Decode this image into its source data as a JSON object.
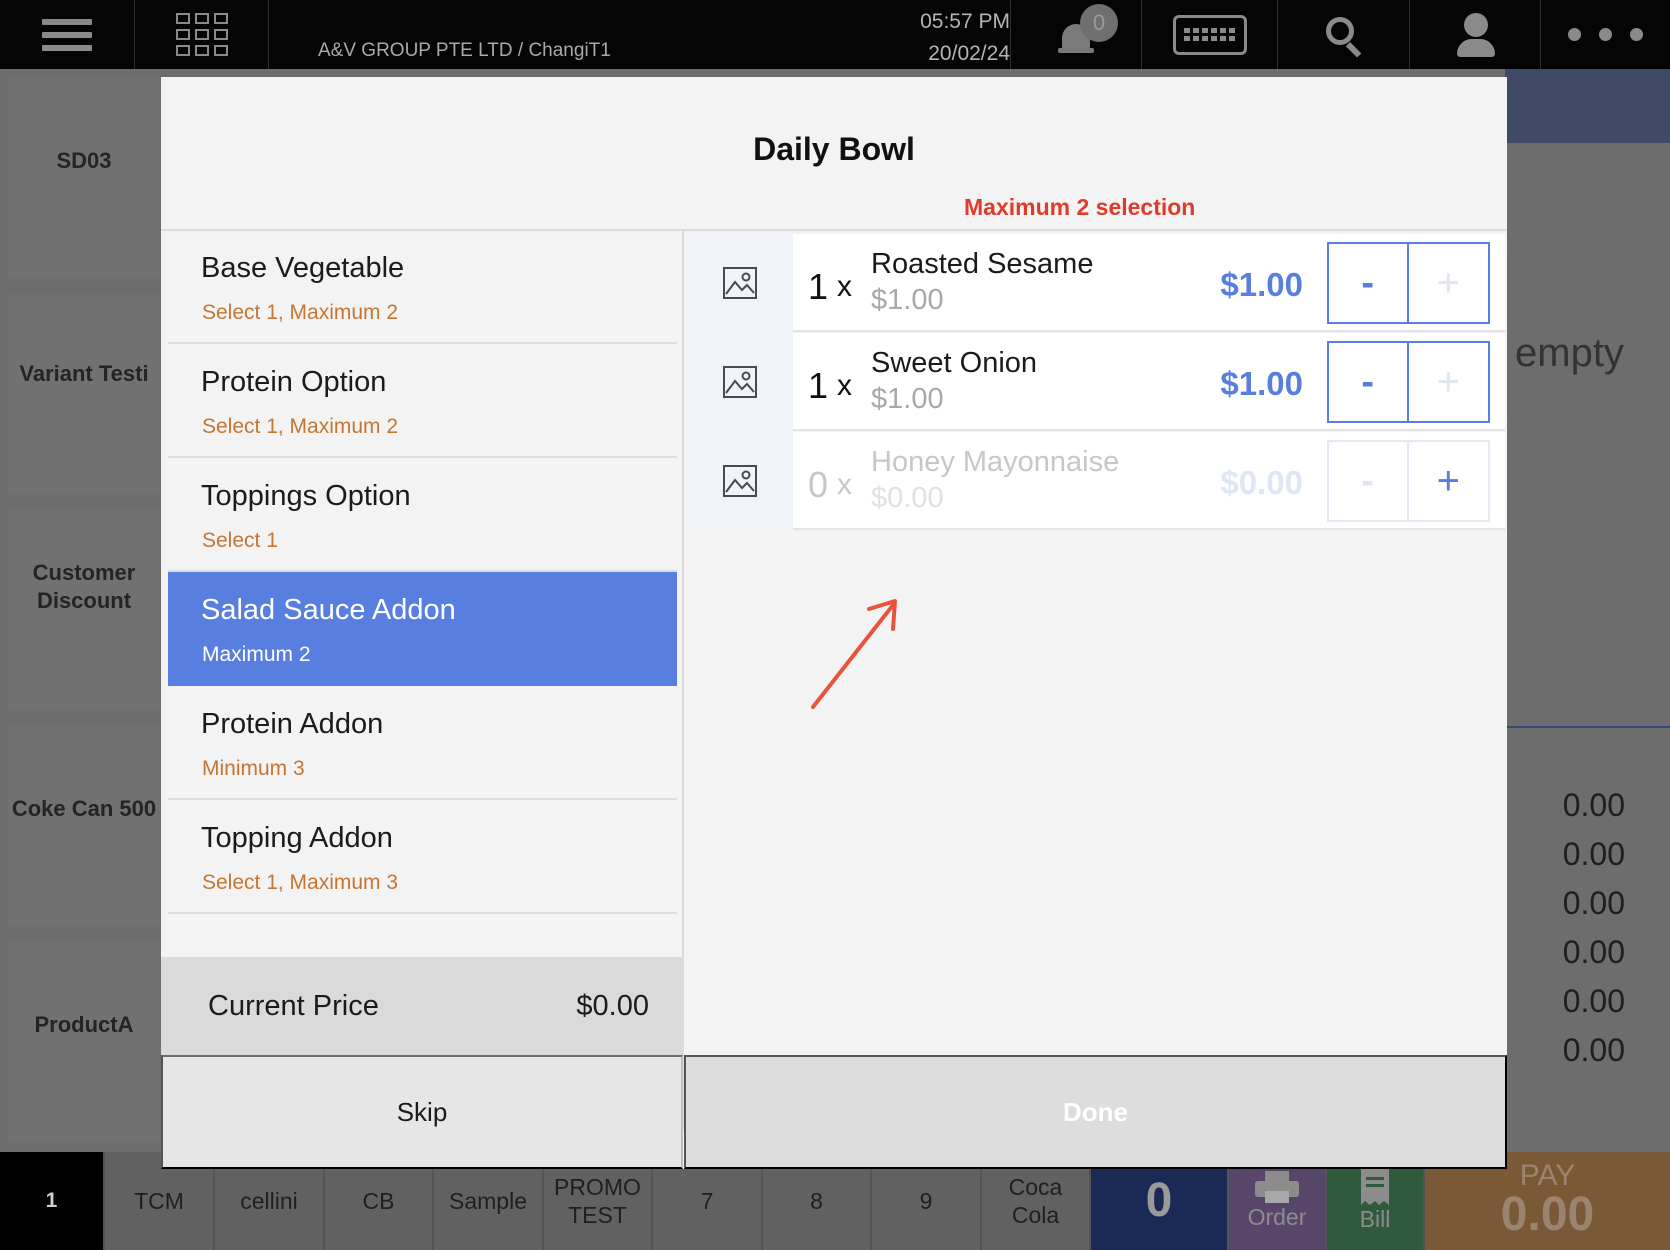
{
  "topbar": {
    "company": "A&V GROUP PTE LTD / ChangiT1",
    "time": "05:57 PM",
    "date": "20/02/24",
    "notification_count": "0"
  },
  "background": {
    "left_cells": [
      "SD03",
      "Variant Testi",
      "Customer\nDiscount",
      "Coke Can 500",
      "ProductA"
    ],
    "cart_empty_text": "empty",
    "summary_values": [
      "0.00",
      "0.00",
      "0.00",
      "0.00",
      "0.00",
      "0.00"
    ]
  },
  "bottombar": {
    "table_number": "1",
    "quick_items": [
      "TCM",
      "cellini",
      "CB",
      "Sample",
      "PROMO\nTEST",
      "7",
      "8",
      "9",
      "Coca Cola"
    ],
    "count": "0",
    "order_label": "Order",
    "bill_label": "Bill",
    "pay_label": "PAY",
    "pay_amount": "0.00"
  },
  "modal": {
    "title": "Daily Bowl",
    "max_note": "Maximum 2 selection",
    "categories": [
      {
        "name": "Base Vegetable",
        "rule": "Select 1, Maximum  2"
      },
      {
        "name": "Protein Option",
        "rule": "Select 1, Maximum  2"
      },
      {
        "name": "Toppings Option",
        "rule": "Select 1"
      },
      {
        "name": "Salad Sauce Addon",
        "rule": "Maximum  2",
        "active": true
      },
      {
        "name": "Protein Addon",
        "rule": "Minimum 3"
      },
      {
        "name": "Topping Addon",
        "rule": "Select 1, Maximum 3"
      }
    ],
    "options": [
      {
        "qty": "1",
        "name": "Roasted Sesame",
        "unit_price": "$1.00",
        "total": "$1.00"
      },
      {
        "qty": "1",
        "name": "Sweet Onion",
        "unit_price": "$1.00",
        "total": "$1.00"
      },
      {
        "qty": "0",
        "name": "Honey Mayonnaise",
        "unit_price": "$0.00",
        "total": "$0.00"
      }
    ],
    "quantity_multiplier": "x",
    "minus_label": "-",
    "plus_label": "+",
    "current_price_label": "Current Price",
    "current_price_value": "$0.00",
    "skip_label": "Skip",
    "done_label": "Done"
  },
  "colors": {
    "accent": "#587ee0",
    "warning": "#e03a2a",
    "rule_text": "#c67632",
    "annotation_arrow": "#e8533b"
  }
}
